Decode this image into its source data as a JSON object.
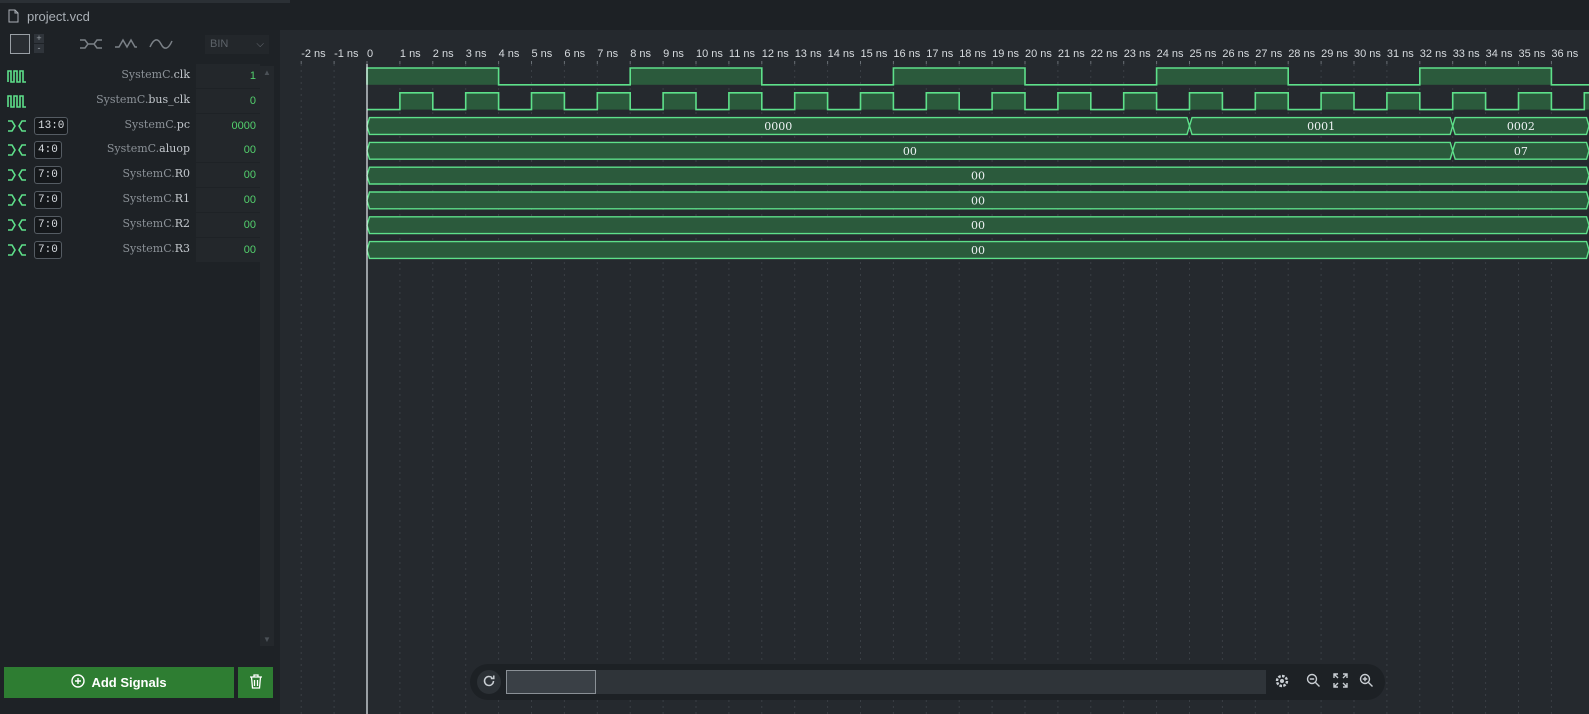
{
  "tab": {
    "filename": "project.vcd"
  },
  "toolbar": {
    "radix": "BIN",
    "increment": "+",
    "decrement": "-"
  },
  "signals": [
    {
      "name_prefix": "SystemC.",
      "name": "clk",
      "type": "clock",
      "width": "",
      "value": "1"
    },
    {
      "name_prefix": "SystemC.",
      "name": "bus_clk",
      "type": "clock",
      "width": "",
      "value": "0"
    },
    {
      "name_prefix": "SystemC.",
      "name": "pc",
      "type": "bus",
      "width": "13:0",
      "value": "0000"
    },
    {
      "name_prefix": "SystemC.",
      "name": "aluop",
      "type": "bus",
      "width": "4:0",
      "value": "00"
    },
    {
      "name_prefix": "SystemC.",
      "name": "R0",
      "type": "bus",
      "width": "7:0",
      "value": "00"
    },
    {
      "name_prefix": "SystemC.",
      "name": "R1",
      "type": "bus",
      "width": "7:0",
      "value": "00"
    },
    {
      "name_prefix": "SystemC.",
      "name": "R2",
      "type": "bus",
      "width": "7:0",
      "value": "00"
    },
    {
      "name_prefix": "SystemC.",
      "name": "R3",
      "type": "bus",
      "width": "7:0",
      "value": "00"
    }
  ],
  "timeline": {
    "unit": "ns",
    "tick_labels": [
      "-2 ns",
      "-1 ns",
      "0",
      "1 ns",
      "2 ns",
      "3 ns",
      "4 ns",
      "5 ns",
      "6 ns",
      "7 ns",
      "8 ns",
      "9 ns",
      "10 ns",
      "11 ns",
      "12 ns",
      "13 ns",
      "14 ns",
      "15 ns",
      "16 ns",
      "17 ns",
      "18 ns",
      "19 ns",
      "20 ns",
      "21 ns",
      "22 ns",
      "23 ns",
      "24 ns",
      "25 ns",
      "26 ns",
      "27 ns",
      "28 ns",
      "29 ns",
      "30 ns",
      "31 ns",
      "32 ns",
      "33 ns",
      "34 ns",
      "35 ns",
      "36 ns"
    ],
    "tick_values": [
      -2,
      -1,
      0,
      1,
      2,
      3,
      4,
      5,
      6,
      7,
      8,
      9,
      10,
      11,
      12,
      13,
      14,
      15,
      16,
      17,
      18,
      19,
      20,
      21,
      22,
      23,
      24,
      25,
      26,
      27,
      28,
      29,
      30,
      31,
      32,
      33,
      34,
      35,
      36
    ],
    "cursor_time": 0
  },
  "waveforms": {
    "clk": {
      "period": 8,
      "high_start": 0,
      "high_duration": 4
    },
    "bus_clk": {
      "period": 2,
      "high_start": 1,
      "high_duration": 1
    },
    "pc": [
      {
        "start": 0,
        "end": 25,
        "value": "0000"
      },
      {
        "start": 25,
        "end": 33,
        "value": "0001"
      },
      {
        "start": 33,
        "end": 37.5,
        "value": "0002"
      }
    ],
    "aluop": [
      {
        "start": 0,
        "end": 33,
        "value": "00"
      },
      {
        "start": 33,
        "end": 37.5,
        "value": "07"
      }
    ],
    "R0": [
      {
        "start": 0,
        "end": 37.5,
        "value": "00"
      }
    ],
    "R1": [
      {
        "start": 0,
        "end": 37.5,
        "value": "00"
      }
    ],
    "R2": [
      {
        "start": 0,
        "end": 37.5,
        "value": "00"
      }
    ],
    "R3": [
      {
        "start": 0,
        "end": 37.5,
        "value": "00"
      }
    ]
  },
  "buttons": {
    "add_signals": "Add Signals"
  },
  "colors": {
    "signal": "#5ee08a",
    "signal_fill": "#2b5a3c",
    "grid": "#3a3f45",
    "cursor": "#e8eef2",
    "accent_button": "#2e7d32"
  }
}
